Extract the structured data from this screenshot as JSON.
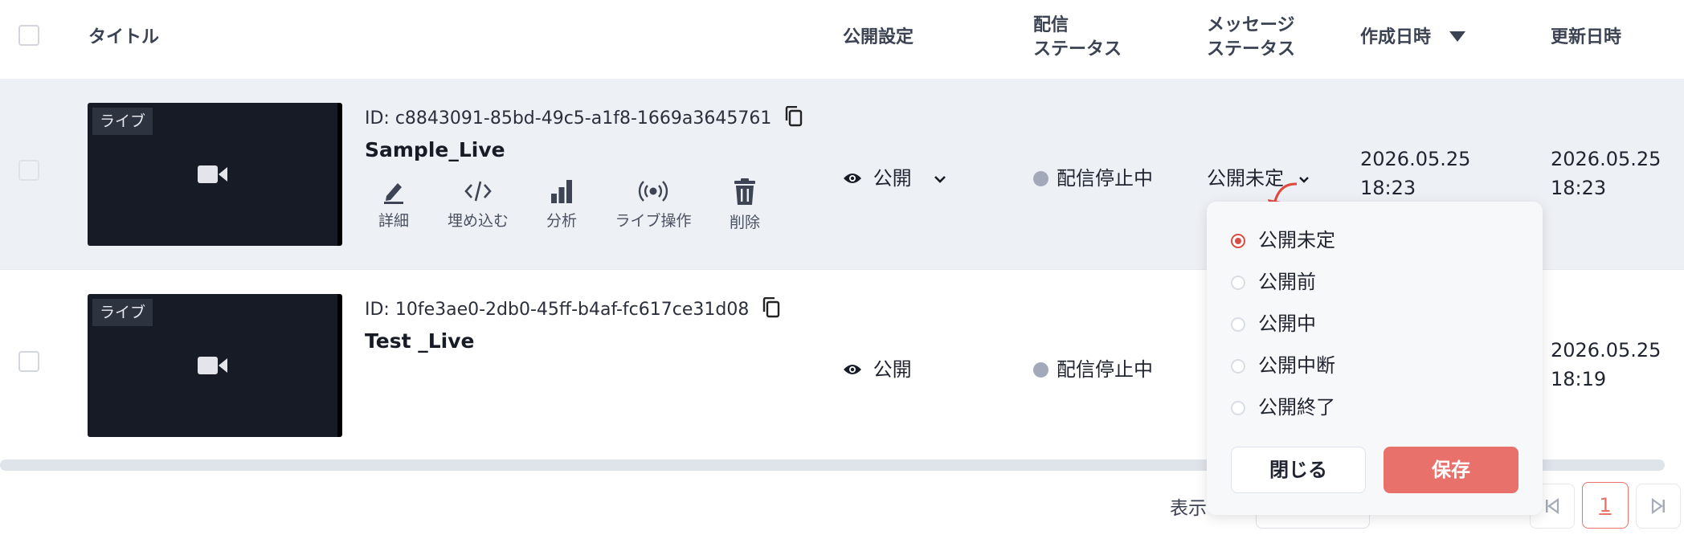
{
  "header": {
    "title": "タイトル",
    "visibility": "公開設定",
    "delivery_status": [
      "配信",
      "ステータス"
    ],
    "message_status": [
      "メッセージ",
      "ステータス"
    ],
    "created_at": "作成日時",
    "updated_at": "更新日時"
  },
  "rows": [
    {
      "badge": "ライブ",
      "id": "ID: c8843091-85bd-49c5-a1f8-1669a3645761",
      "title": "Sample_Live",
      "actions": [
        "詳細",
        "埋め込む",
        "分析",
        "ライブ操作",
        "削除"
      ],
      "visibility": "公開",
      "delivery": "配信停止中",
      "message_status": "公開未定",
      "created": [
        "2026.05.25",
        "18:23"
      ],
      "updated": [
        "2026.05.25",
        "18:23"
      ]
    },
    {
      "badge": "ライブ",
      "id": "ID: 10fe3ae0-2db0-45ff-b4af-fc617ce31d08",
      "title": "Test _Live",
      "visibility": "公開",
      "delivery": "配信停止中",
      "updated": [
        "2026.05.25",
        "18:19"
      ]
    }
  ],
  "dropdown": {
    "options": [
      "公開未定",
      "公開前",
      "公開中",
      "公開中断",
      "公開終了"
    ],
    "selected": "公開未定",
    "close_label": "閉じる",
    "save_label": "保存"
  },
  "footer": {
    "display_label": "表示",
    "current_page": "1"
  },
  "colors": {
    "accent": "#e8716c",
    "radio_selected": "#d94c43",
    "row_highlight": "#edf0f5"
  }
}
